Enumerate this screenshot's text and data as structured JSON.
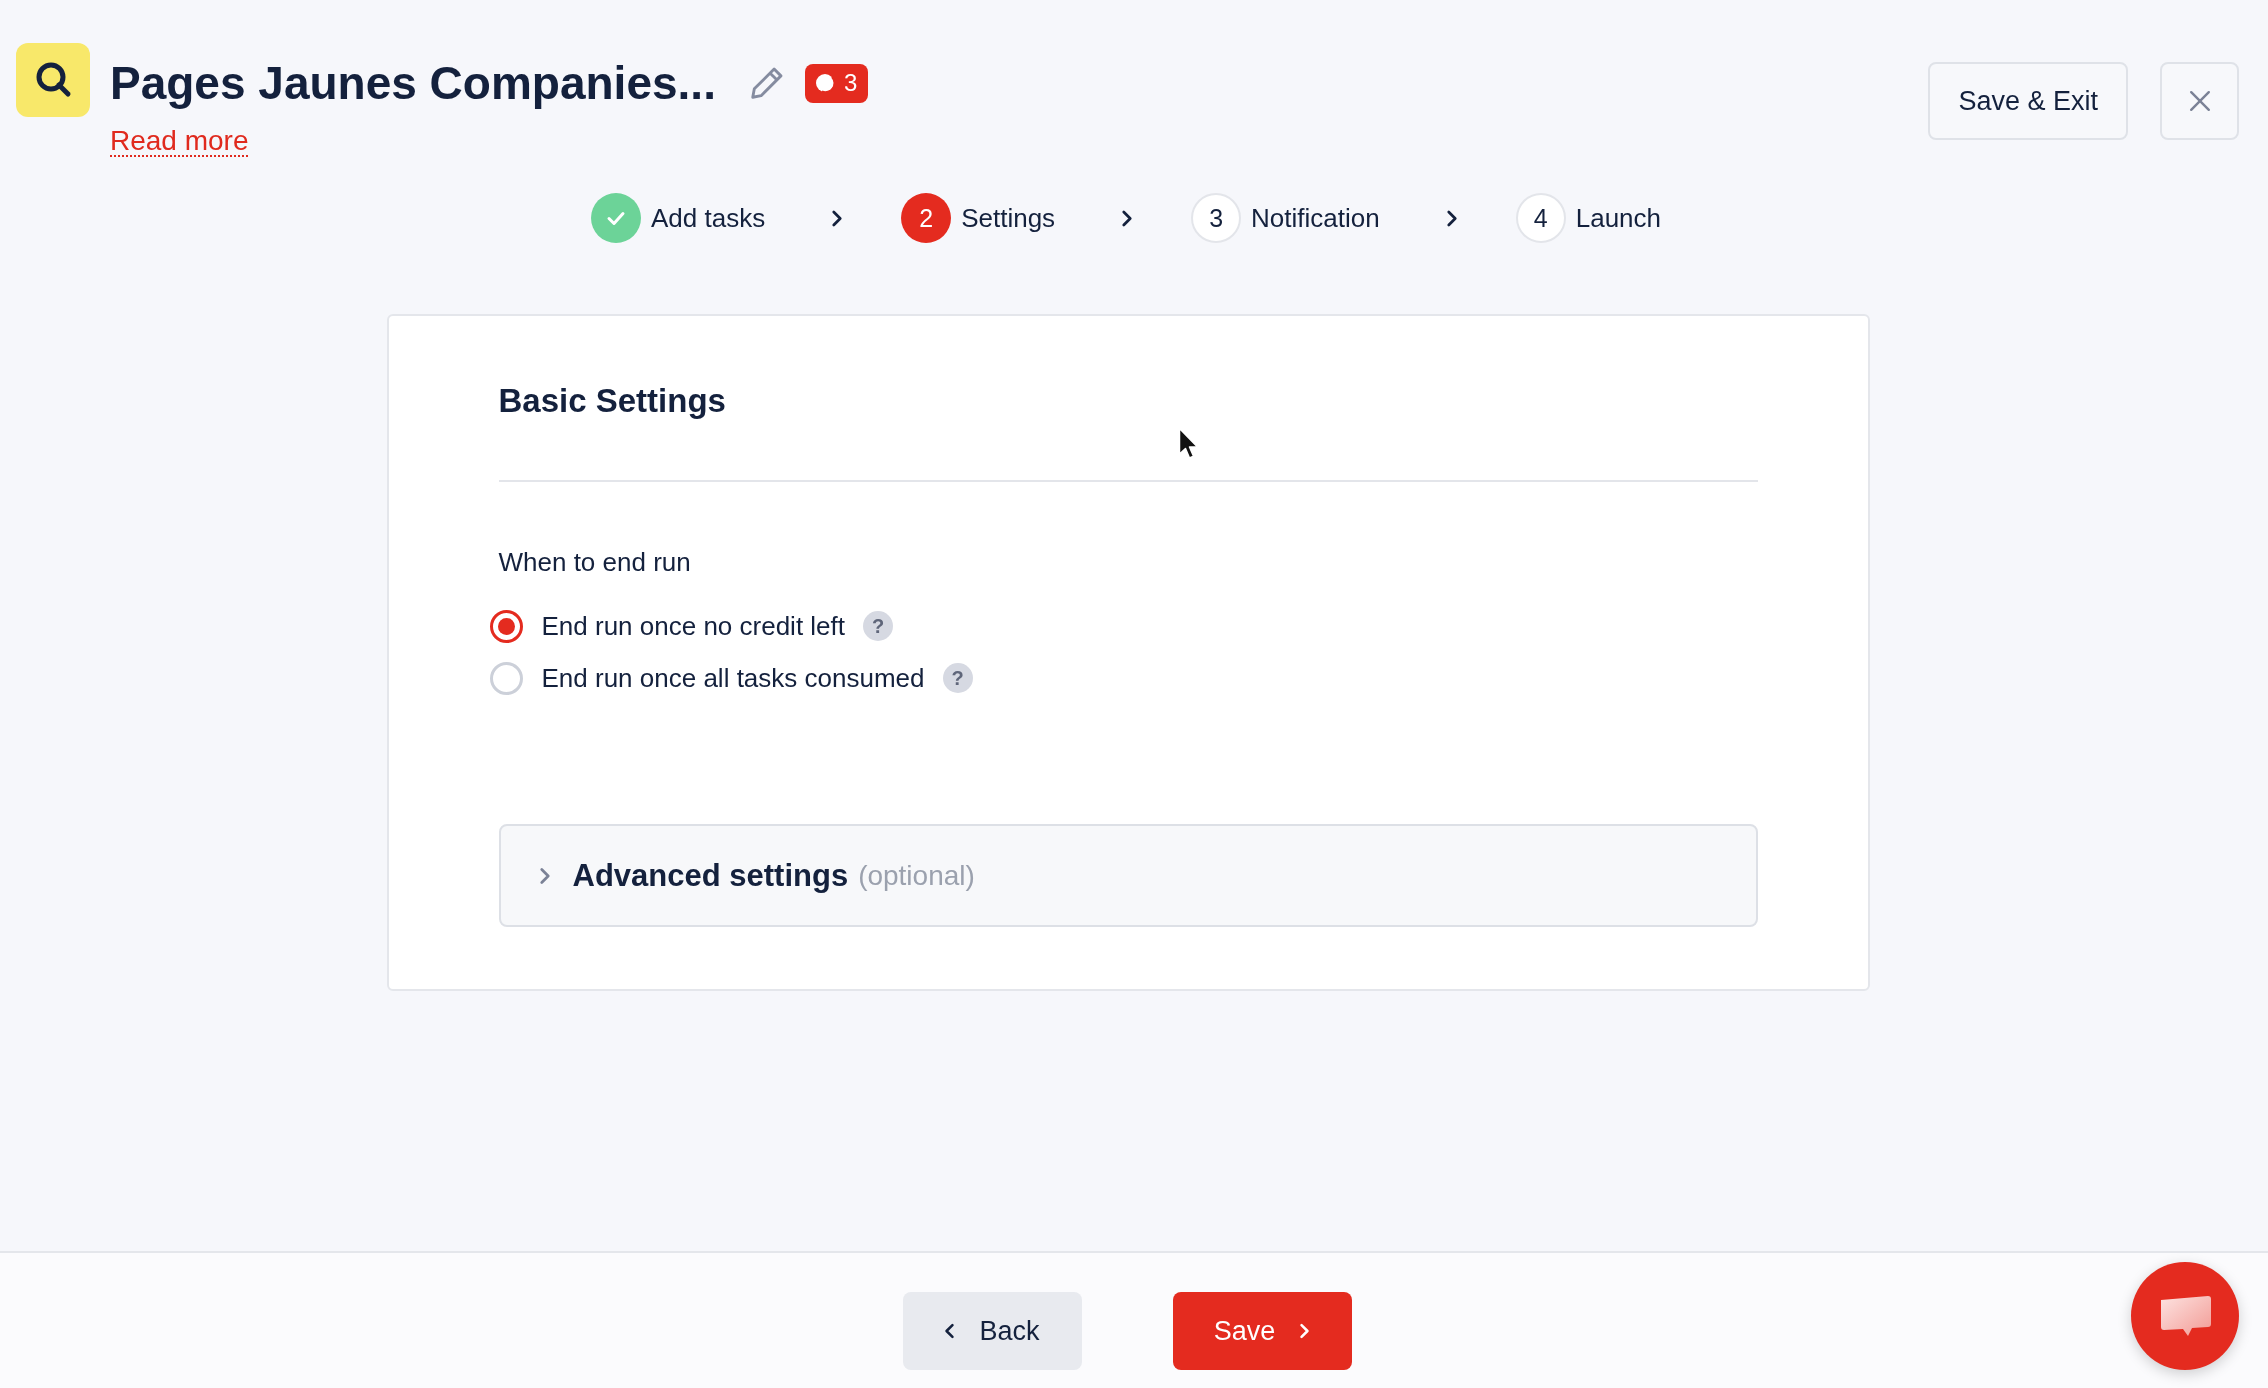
{
  "header": {
    "title": "Pages Jaunes Companies...",
    "credits_badge": {
      "count": "3"
    },
    "read_more_link": "Read more",
    "save_exit_button": "Save & Exit"
  },
  "steps": [
    {
      "completed": true,
      "selected": false,
      "label": "Add tasks"
    },
    {
      "completed": false,
      "selected": true,
      "number": "2",
      "label": "Settings"
    },
    {
      "completed": false,
      "selected": false,
      "number": "3",
      "label": "Notification"
    },
    {
      "completed": false,
      "selected": false,
      "number": "4",
      "label": "Launch"
    }
  ],
  "card": {
    "title": "Basic Settings",
    "section_label": "When to end run",
    "options": [
      {
        "label": "End run once no credit left",
        "selected": true,
        "hint": "?"
      },
      {
        "label": "End run once all tasks consumed",
        "selected": false,
        "hint": "?"
      }
    ],
    "advanced_settings": {
      "title": "Advanced settings",
      "note": "(optional)",
      "expanded": false
    }
  },
  "footer": {
    "buttons": [
      {
        "kind": "secondary",
        "label": "Back"
      },
      {
        "kind": "primary",
        "label": "Save"
      }
    ]
  }
}
